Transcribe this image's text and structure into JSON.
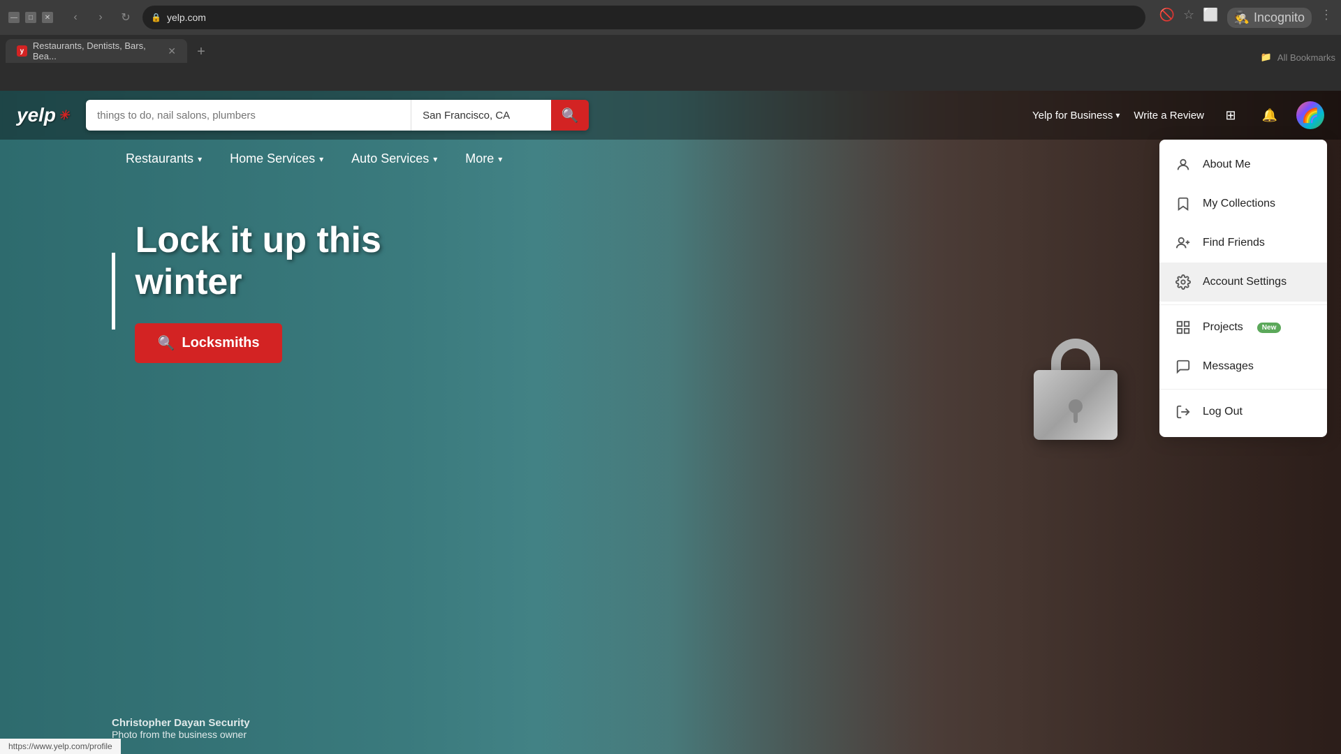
{
  "browser": {
    "url": "yelp.com",
    "tab_title": "Restaurants, Dentists, Bars, Bea...",
    "incognito_label": "Incognito",
    "bookmarks_label": "All Bookmarks"
  },
  "header": {
    "logo": "yelp",
    "search_placeholder": "things to do, nail salons, plumbers",
    "location_value": "San Francisco, CA",
    "yelp_for_business": "Yelp for Business",
    "write_review": "Write a Review"
  },
  "nav": {
    "items": [
      {
        "label": "Restaurants",
        "has_dropdown": true
      },
      {
        "label": "Home Services",
        "has_dropdown": true
      },
      {
        "label": "Auto Services",
        "has_dropdown": true
      },
      {
        "label": "More",
        "has_dropdown": true
      }
    ]
  },
  "hero": {
    "title_line1": "Lock it up this",
    "title_line2": "winter",
    "cta_label": "Locksmiths",
    "photo_business": "Christopher Dayan Security",
    "photo_credit": "Photo from the business owner"
  },
  "dropdown": {
    "items": [
      {
        "id": "about-me",
        "label": "About Me",
        "icon": "person"
      },
      {
        "id": "my-collections",
        "label": "My Collections",
        "icon": "bookmark"
      },
      {
        "id": "find-friends",
        "label": "Find Friends",
        "icon": "person-add"
      },
      {
        "id": "account-settings",
        "label": "Account Settings",
        "icon": "gear",
        "highlighted": true
      }
    ],
    "divider1": true,
    "items2": [
      {
        "id": "projects",
        "label": "Projects",
        "icon": "grid",
        "badge": "New"
      },
      {
        "id": "messages",
        "label": "Messages",
        "icon": "chat"
      }
    ],
    "divider2": true,
    "items3": [
      {
        "id": "log-out",
        "label": "Log Out",
        "icon": "exit"
      }
    ]
  },
  "status_bar": {
    "url": "https://www.yelp.com/profile"
  }
}
